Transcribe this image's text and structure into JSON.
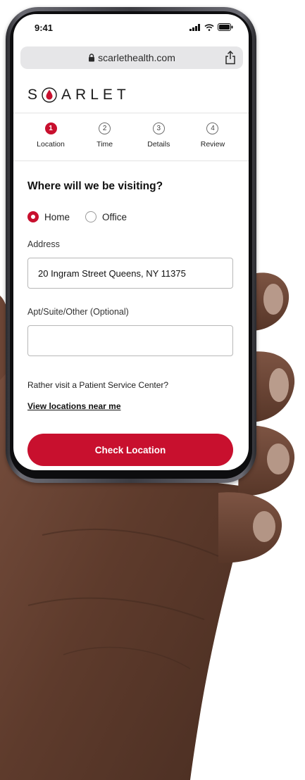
{
  "colors": {
    "brand_red": "#c8102e",
    "text_dark": "#111111",
    "field_border": "#b8b8b8",
    "skin_tone": "#6b4636"
  },
  "status_bar": {
    "time": "9:41",
    "icons": [
      "signal-icon",
      "wifi-icon",
      "battery-icon"
    ]
  },
  "browser": {
    "url": "scarlethealth.com",
    "lock_icon": "lock-icon",
    "share_icon": "share-icon"
  },
  "brand": {
    "letters_before": "S",
    "letters_after": "ARLET",
    "logo_icon": "blood-drop-icon"
  },
  "stepper": {
    "steps": [
      {
        "number": "1",
        "label": "Location",
        "active": true
      },
      {
        "number": "2",
        "label": "Time",
        "active": false
      },
      {
        "number": "3",
        "label": "Details",
        "active": false
      },
      {
        "number": "4",
        "label": "Review",
        "active": false
      }
    ]
  },
  "form": {
    "question": "Where will we be visiting?",
    "radio_options": [
      {
        "label": "Home",
        "selected": true
      },
      {
        "label": "Office",
        "selected": false
      }
    ],
    "address_label": "Address",
    "address_value": "20 Ingram Street Queens, NY 11375",
    "apt_label": "Apt/Suite/Other (Optional)",
    "apt_value": ""
  },
  "psc": {
    "prompt": "Rather visit a Patient Service Center?",
    "link": "View locations near me"
  },
  "cta": {
    "label": "Check Location"
  }
}
